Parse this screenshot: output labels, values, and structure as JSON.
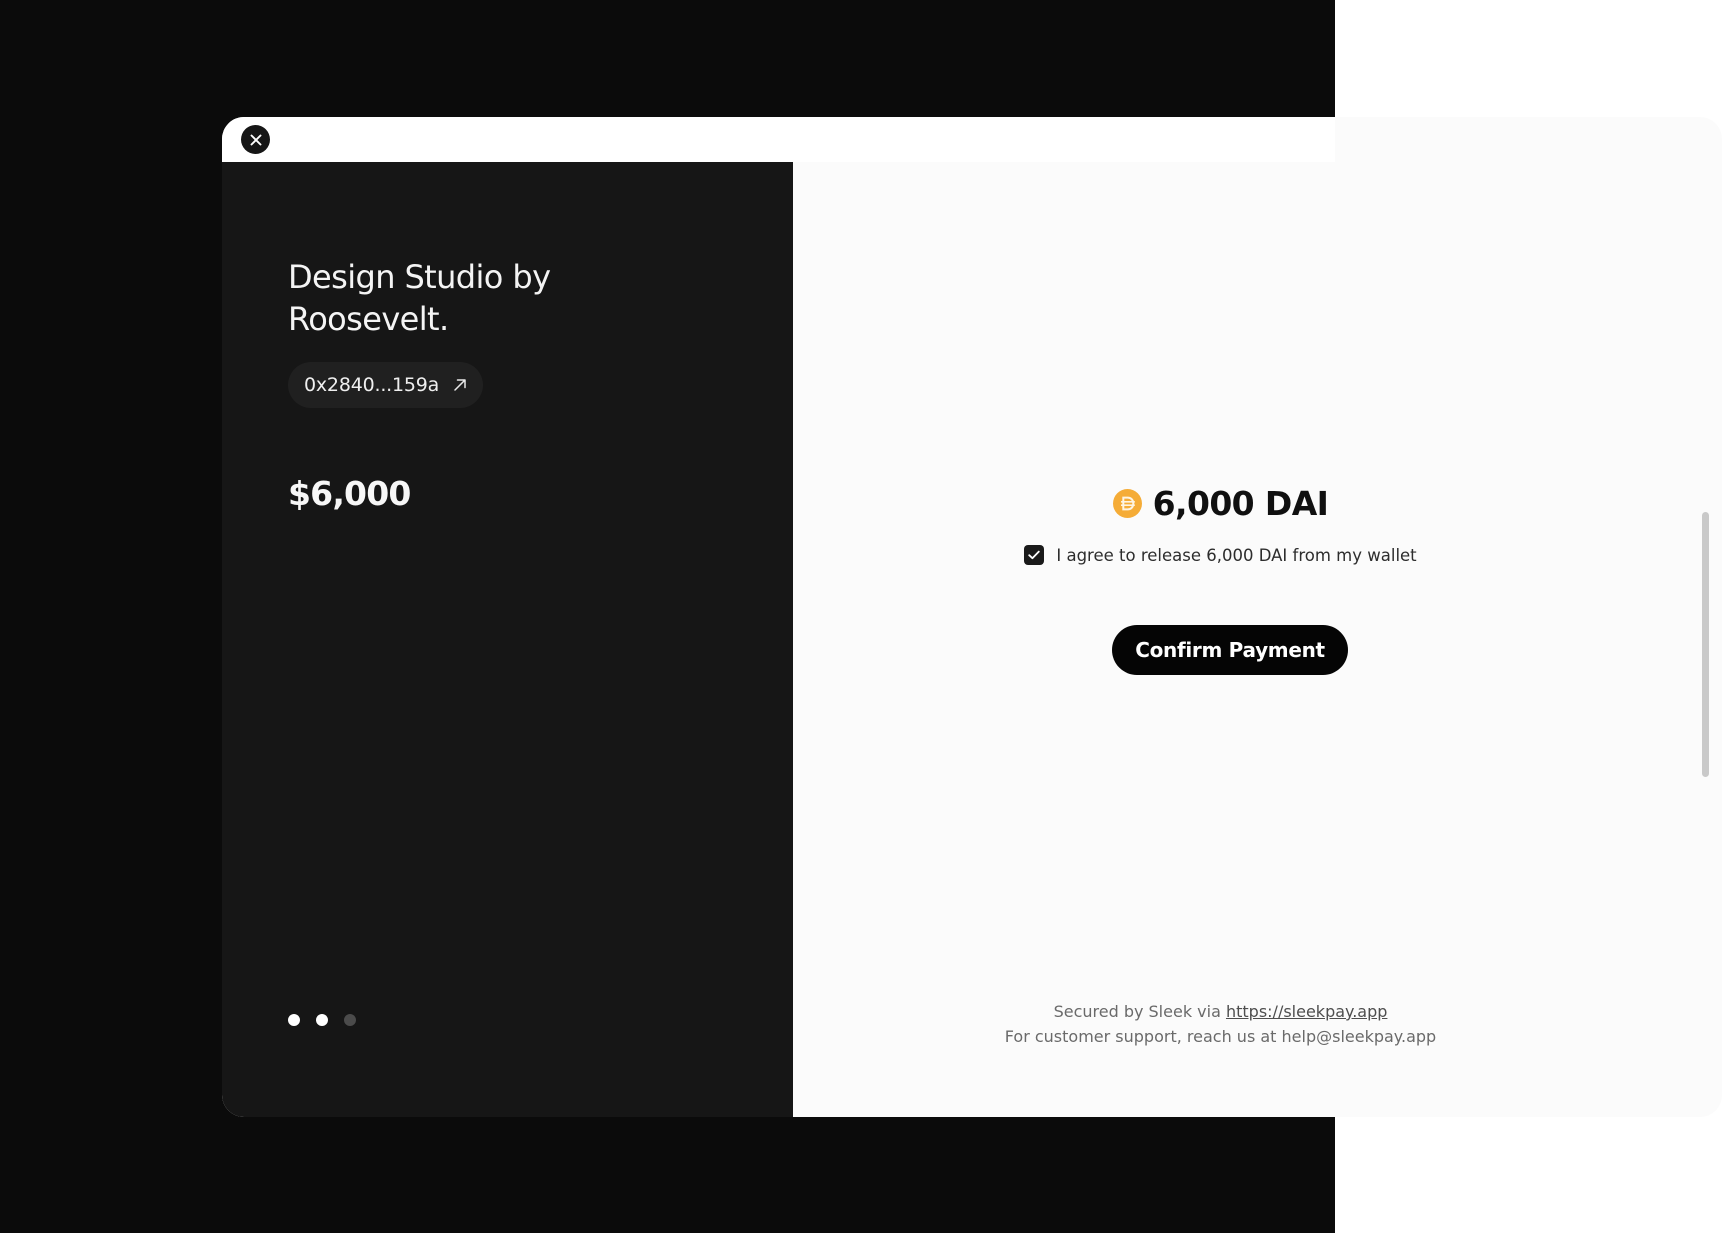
{
  "merchant": {
    "name": "Design Studio by Roosevelt.",
    "wallet_address": "0x2840...159a",
    "price": "$6,000"
  },
  "payment": {
    "amount": "6,000 DAI",
    "agreement": "I agree to release 6,000 DAI from my wallet",
    "agreed": true,
    "confirm_label": "Confirm Payment"
  },
  "footer": {
    "secured_prefix": "Secured by Sleek via",
    "secured_link": "https://sleekpay.app",
    "support": "For customer support, reach us at help@sleekpay.app"
  },
  "carousel": {
    "total": 3,
    "active": [
      0,
      1
    ]
  },
  "colors": {
    "left_panel": "#161616",
    "right_panel": "#fbfbfb",
    "coin": "#f5ac37",
    "button": "#050505"
  },
  "icons": {
    "close": "close-icon",
    "external_link": "arrow-up-right-icon",
    "coin": "dai-coin-icon",
    "check": "check-icon"
  }
}
